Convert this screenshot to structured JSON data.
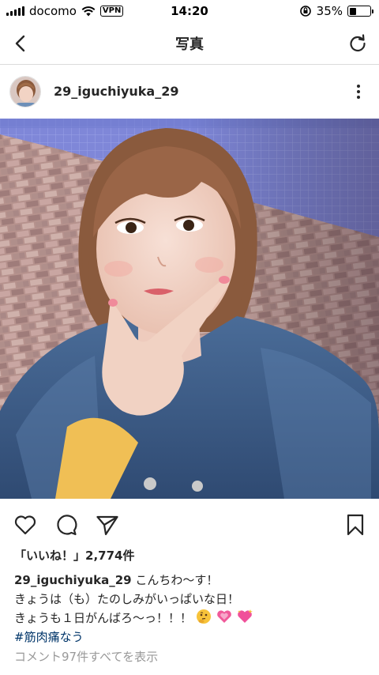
{
  "status_bar": {
    "carrier": "docomo",
    "vpn": "VPN",
    "time": "14:20",
    "battery_percent": "35%",
    "battery_level": 0.35
  },
  "nav": {
    "title": "写真",
    "back_icon": "chevron-left-icon",
    "refresh_icon": "refresh-icon"
  },
  "post": {
    "username": "29_iguchiyuka_29",
    "more_icon": "more-vertical-icon"
  },
  "actions": {
    "like_icon": "heart-icon",
    "comment_icon": "comment-icon",
    "share_icon": "send-icon",
    "save_icon": "bookmark-icon"
  },
  "likes": {
    "label": "「いいね！」",
    "count": "2,774件"
  },
  "caption": {
    "username": "29_iguchiyuka_29",
    "line1": "こんちわ〜す！",
    "line2": "きょうは（も）たのしみがいっぱいな日！",
    "line3": "きょうも１日がんばろ〜っ！！！",
    "emojis": [
      "thinking-face-icon",
      "growing-heart-icon",
      "sparkling-heart-icon"
    ],
    "hashtag": "#筋肉痛なう"
  },
  "comments": {
    "view_all": "コメント97件すべてを表示"
  },
  "colors": {
    "text": "#262626",
    "hashtag": "#003569",
    "muted": "#999999",
    "divider": "#dbdbdb"
  }
}
